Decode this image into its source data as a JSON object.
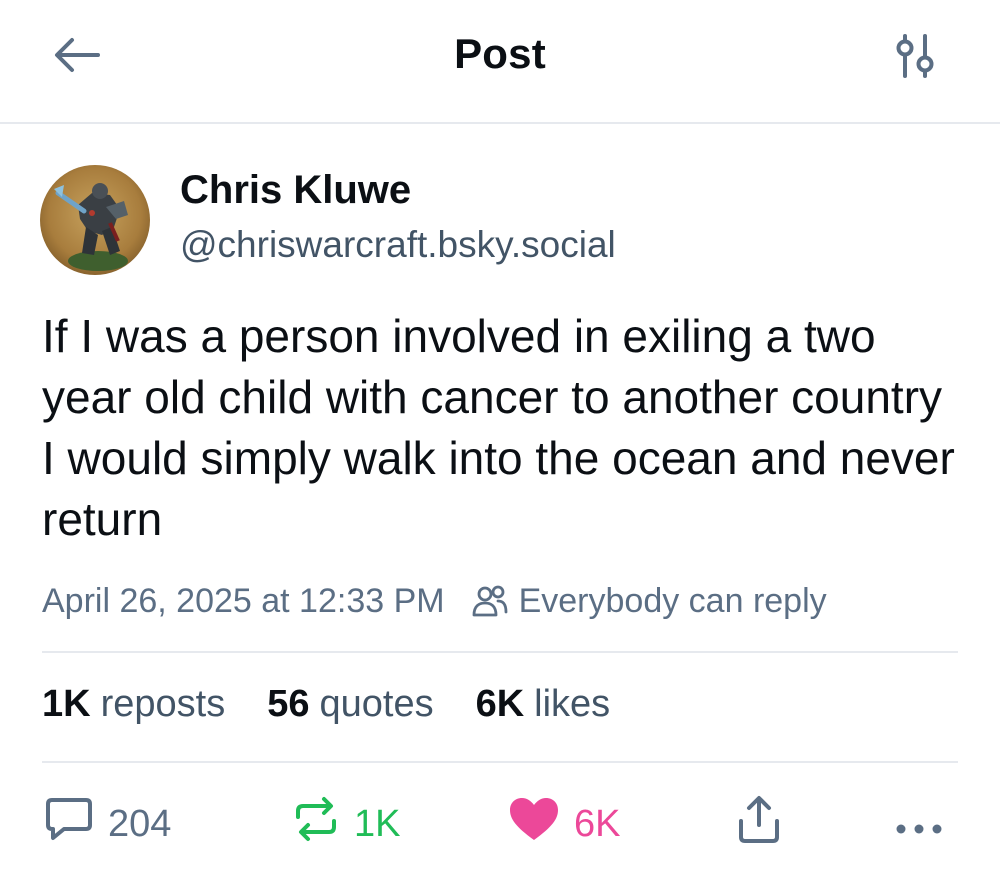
{
  "header": {
    "title": "Post",
    "back_icon": "arrow-left-icon",
    "filter_icon": "sliders-icon"
  },
  "author": {
    "display_name": "Chris Kluwe",
    "handle": "@chriswarcraft.bsky.social",
    "avatar": "miniature-figure-avatar"
  },
  "post": {
    "text": "If I was a person involved in exiling a two year old child with cancer to another country I would simply walk into the ocean and never return",
    "timestamp": "April 26, 2025 at 12:33 PM",
    "reply_setting": "Everybody can reply",
    "reply_setting_icon": "people-icon"
  },
  "stats": {
    "reposts_count": "1K",
    "reposts_label": "reposts",
    "quotes_count": "56",
    "quotes_label": "quotes",
    "likes_count": "6K",
    "likes_label": "likes"
  },
  "actions": {
    "reply_count": "204",
    "repost_count": "1K",
    "like_count": "6K",
    "reply_icon": "speech-bubble-icon",
    "repost_icon": "repost-arrows-icon",
    "like_icon": "heart-icon",
    "share_icon": "share-icon",
    "more_icon": "more-dots-icon"
  },
  "colors": {
    "text_primary": "#0b0f14",
    "text_secondary": "#5b6e84",
    "repost_green": "#20bc57",
    "like_pink": "#ec4899",
    "divider": "#e6e9ee"
  }
}
